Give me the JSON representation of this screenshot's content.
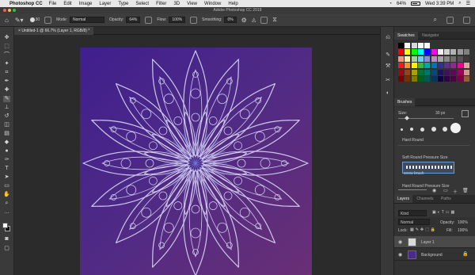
{
  "menubar": {
    "app_name": "Photoshop CC",
    "menus": [
      "File",
      "Edit",
      "Image",
      "Layer",
      "Type",
      "Select",
      "Filter",
      "3D",
      "View",
      "Window",
      "Help"
    ],
    "battery": "64%",
    "time": "Wed 3:39 PM"
  },
  "window": {
    "title": "Adobe Photoshop CC 2019"
  },
  "options": {
    "mode_label": "Mode:",
    "mode_value": "Normal",
    "opacity_label": "Opacity:",
    "opacity_value": "64%",
    "flow_label": "Flow:",
    "flow_value": "100%",
    "smoothing_label": "Smoothing:",
    "smoothing_value": "0%"
  },
  "document": {
    "tab_title": "Untitled-1 @ 66.7% (Layer 1, RGB/8) *"
  },
  "swatches_panel": {
    "tabs": [
      "Swatches",
      "Navigator"
    ],
    "rows": [
      [
        "#000000",
        "#ffffff",
        "#d8d8d8",
        "#ffffff",
        "#ffffff"
      ],
      [
        "#ff0000",
        "#ffff00",
        "#00ff00",
        "#00ffff",
        "#0000ff",
        "#ff00ff",
        "#f2f2f2",
        "#d0d0d0",
        "#b3b3b3",
        "#999999",
        "#808080"
      ],
      [
        "#f7977a",
        "#fff79a",
        "#a2d39c",
        "#6ecff6",
        "#8493ca",
        "#bc8dbf",
        "#a3a3a3",
        "#888888",
        "#6e6e6e",
        "#545454",
        "#3b3b3b"
      ],
      [
        "#ee1d24",
        "#f7941d",
        "#fff200",
        "#39b54a",
        "#00a99d",
        "#0072bc",
        "#2e3192",
        "#662d91",
        "#92278f",
        "#ec008c",
        "#e2a2a2"
      ],
      [
        "#9e0b0f",
        "#a0410d",
        "#aba000",
        "#007236",
        "#00746b",
        "#004a80",
        "#1b1464",
        "#440e62",
        "#630460",
        "#9e005d",
        "#c79a8c"
      ],
      [
        "#790000",
        "#7b2e00",
        "#827b00",
        "#005e20",
        "#005952",
        "#003663",
        "#0d004c",
        "#32004b",
        "#4b0049",
        "#7b0046",
        "#8c6239"
      ]
    ]
  },
  "brushes_panel": {
    "tab": "Brushes",
    "size_label": "Size:",
    "size_value": "30 px",
    "brush_names": [
      "Hard Round",
      "Soft Round Pressure Size",
      "snow brush",
      "Hard Round Pressure Size"
    ]
  },
  "layers_panel": {
    "tabs": [
      "Layers",
      "Channels",
      "Paths"
    ],
    "kind_label": "Kind",
    "blend_mode": "Normal",
    "opacity_label": "Opacity:",
    "opacity_value": "100%",
    "lock_label": "Lock:",
    "fill_label": "Fill:",
    "fill_value": "100%",
    "layers": [
      {
        "name": "Layer 1",
        "thumb": "#d9d9d9"
      },
      {
        "name": "Background",
        "thumb": "#4a2a8a"
      }
    ]
  },
  "colors": {
    "canvas_gradient_start": "#3f1f8e",
    "canvas_gradient_end": "#6a2f75",
    "line_art": "#d6d0f2"
  }
}
